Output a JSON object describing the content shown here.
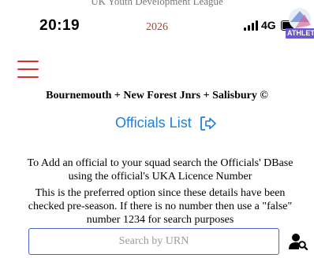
{
  "header": {
    "league": "UK Youth Development League",
    "year": "2026",
    "time": "20:19",
    "network": "4G",
    "logo_text": "ATHLET"
  },
  "page": {
    "club": "Bournemouth + New Forest Jnrs + Salisbury ©",
    "officials_label": "Officials List",
    "info_line1": "To Add an official to your squad search the Officials' DBase using the official's UKA Licence Number",
    "info_line2": "This is the preferred option since these details have been checked pre-season.  If there is no number then use a \"false\" number 1234 for search purposes",
    "search_placeholder": "Search by URN"
  },
  "icons": {
    "menu": "hamburger-menu-icon",
    "officials": "sign-in-icon",
    "search": "user-search-icon"
  },
  "colors": {
    "menu": "#d9322b",
    "link": "#1f7fd6",
    "input_border": "#4c63c8",
    "year": "#c0392b"
  }
}
